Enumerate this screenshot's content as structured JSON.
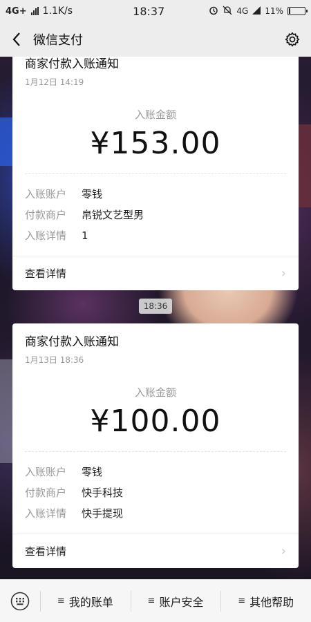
{
  "status_bar": {
    "network": "4G+",
    "speed": "1.1K/s",
    "time": "18:37",
    "right_net": "4G",
    "battery": "11%",
    "battery_level": 0.11
  },
  "nav": {
    "title": "微信支付"
  },
  "cards": [
    {
      "title": "商家付款入账通知",
      "date": "1月12日  14:19",
      "amount_label": "入账金额",
      "amount": "¥153.00",
      "rows": [
        {
          "key": "入账账户",
          "value": "零钱"
        },
        {
          "key": "付款商户",
          "value": "帛锐文艺型男"
        },
        {
          "key": "入账详情",
          "value": "1"
        }
      ],
      "view_label": "查看详情"
    },
    {
      "title": "商家付款入账通知",
      "date": "1月13日  18:36",
      "amount_label": "入账金额",
      "amount": "¥100.00",
      "rows": [
        {
          "key": "入账账户",
          "value": "零钱"
        },
        {
          "key": "付款商户",
          "value": "快手科技"
        },
        {
          "key": "入账详情",
          "value": "快手提现"
        }
      ],
      "view_label": "查看详情"
    }
  ],
  "time_divider": "18:36",
  "bottom_menu": {
    "items": [
      "我的账单",
      "账户安全",
      "其他帮助"
    ]
  }
}
